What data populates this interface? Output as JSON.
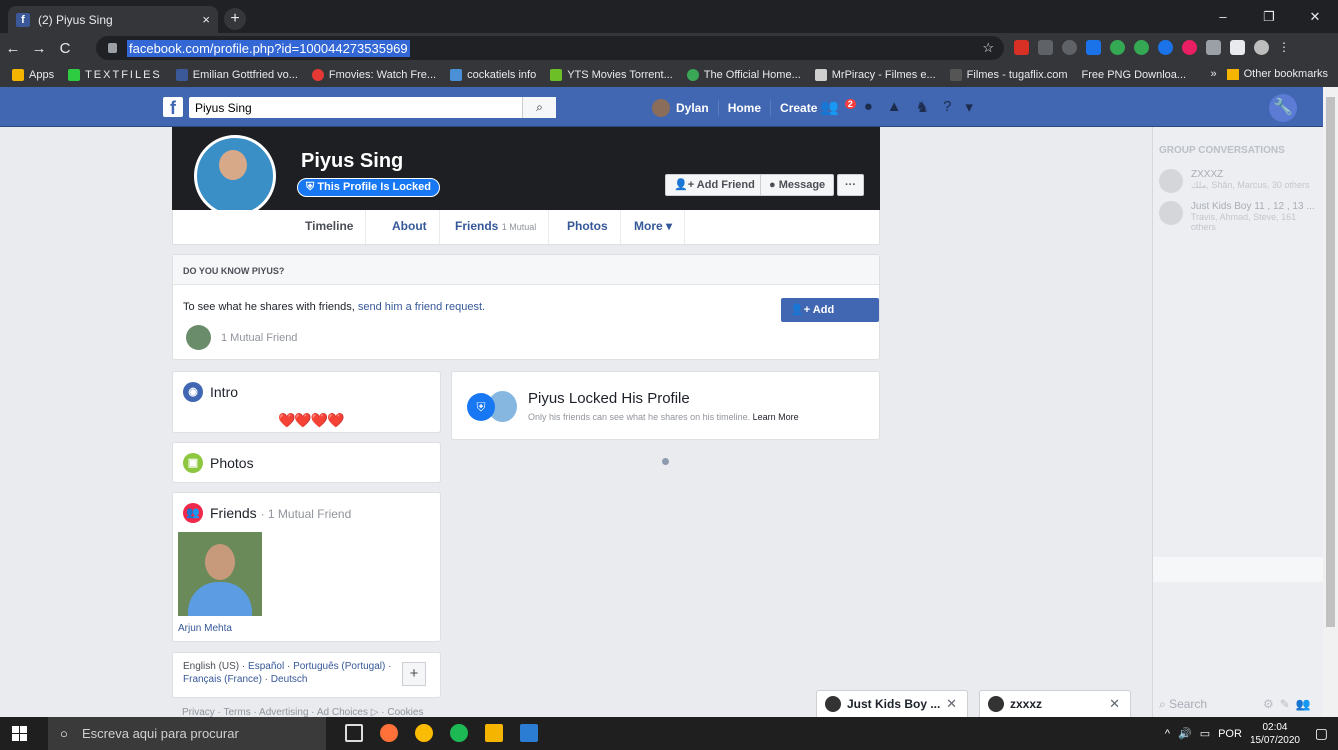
{
  "browser": {
    "tab_title": "(2) Piyus Sing",
    "tab_close": "×",
    "new_tab": "+",
    "url": "facebook.com/profile.php?id=100044273535969",
    "window_controls": [
      "–",
      "❐",
      "✕"
    ],
    "bookmarks": [
      {
        "label": "Apps",
        "color": "#f4b400"
      },
      {
        "label": "TEXTFILES",
        "color": "#2ecc40"
      },
      {
        "label": "Emilian Gottfried vo...",
        "color": "#3b5998"
      },
      {
        "label": "Fmovies: Watch Fre...",
        "color": "#e53935"
      },
      {
        "label": "cockatiels info",
        "color": "#4a90d9"
      },
      {
        "label": "YTS Movies Torrent...",
        "color": "#6cbf26"
      },
      {
        "label": "The Official Home...",
        "color": "#3aa757"
      },
      {
        "label": "MrPiracy - Filmes e...",
        "color": "#cfcfcf"
      },
      {
        "label": "Filmes - tugaflix.com",
        "color": "#555555"
      },
      {
        "label": "Free PNG Downloa...",
        "color": "#35363a"
      }
    ],
    "more_bookmarks": "»",
    "other_bookmarks": "Other bookmarks"
  },
  "fb": {
    "search_value": "Piyus Sing",
    "user_name": "Dylan",
    "nav_home": "Home",
    "nav_create": "Create",
    "friend_badge": "2",
    "profile": {
      "name": "Piyus Sing",
      "locked_label": "This Profile Is Locked",
      "add_friend": "Add Friend",
      "message": "Message",
      "more_dots": "···"
    },
    "tabs": [
      {
        "label": "Timeline"
      },
      {
        "label": "About"
      },
      {
        "label": "Friends",
        "extra": "1 Mutual"
      },
      {
        "label": "Photos"
      },
      {
        "label": "More ▾"
      }
    ],
    "know": {
      "heading": "DO YOU KNOW PIYUS?",
      "text": "To see what he shares with friends,",
      "link": "send him a friend request.",
      "mutual": "1 Mutual Friend",
      "add_friend": "Add Friend"
    },
    "intro": {
      "title": "Intro",
      "hearts": "❤️❤️❤️❤️"
    },
    "photos": {
      "title": "Photos"
    },
    "friends": {
      "title": "Friends",
      "count": "· 1 Mutual Friend",
      "friend_name": "Arjun Mehta"
    },
    "languages": {
      "current": "English (US)",
      "others": [
        "Español",
        "Português (Portugal)",
        "Français (France)",
        "Deutsch"
      ],
      "plus": "+"
    },
    "footer": "Privacy · Terms · Advertising · Ad Choices ▷ · Cookies",
    "locked_post": {
      "title": "Piyus Locked His Profile",
      "sub": "Only his friends can see what he shares on his timeline.",
      "learn_more": "Learn More"
    },
    "chat_sidebar": {
      "heading": "GROUP CONVERSATIONS",
      "groups": [
        {
          "name": "ZXXXZ",
          "members": "ملك, Shân, Marcus, 30 others"
        },
        {
          "name": "Just Kids Boy 11 , 12 , 13 ...",
          "members": "Travis, Ahmad, Steve, 161 others"
        }
      ],
      "search": "Search"
    },
    "chat_tabs": [
      {
        "label": "Just Kids Boy ..."
      },
      {
        "label": "zxxxz"
      }
    ]
  },
  "taskbar": {
    "search_placeholder": "Escreva aqui para procurar",
    "language": "POR",
    "time": "02:04",
    "date": "15/07/2020"
  }
}
